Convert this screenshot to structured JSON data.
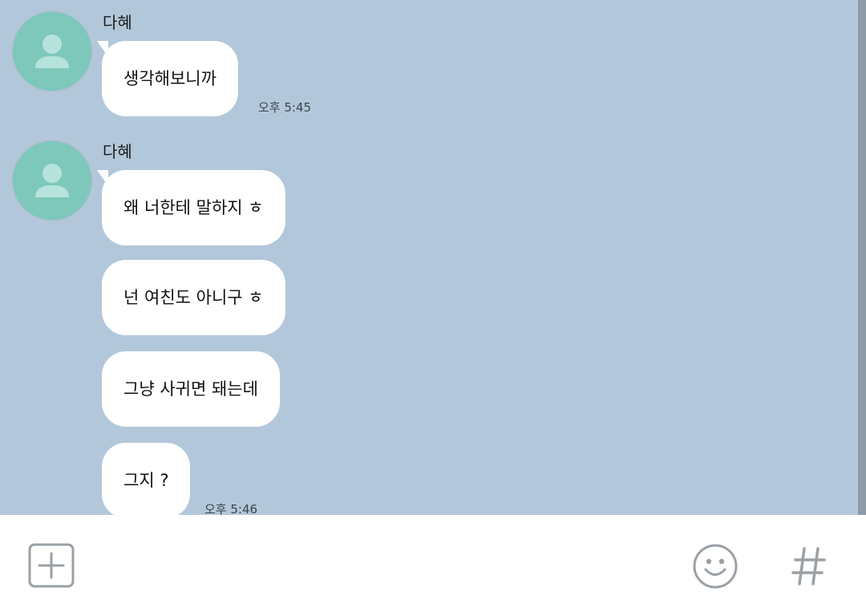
{
  "colors": {
    "chat_background": "#b2c7da",
    "bubble_background": "#ffffff",
    "avatar_background": "#7ec7bb",
    "avatar_figure": "#b6e3db",
    "input_bar_background": "#ffffff",
    "icon_gray": "#9aa0a6",
    "scrollbar": "#8e9aa6"
  },
  "messages": [
    {
      "sender": "다혜",
      "bubbles": [
        "생각해보니까"
      ],
      "time": "오후 5:45"
    },
    {
      "sender": "다혜",
      "bubbles": [
        "왜 너한테 말하지 ㅎ",
        "넌 여친도 아니구 ㅎ",
        "그냥 사귀면 돼는데",
        "그지 ?"
      ],
      "time": "오후 5:46"
    }
  ],
  "input_bar": {
    "add_icon": "plus-square-icon",
    "emoji_icon": "smiley-icon",
    "hashtag_icon": "hashtag-icon"
  }
}
